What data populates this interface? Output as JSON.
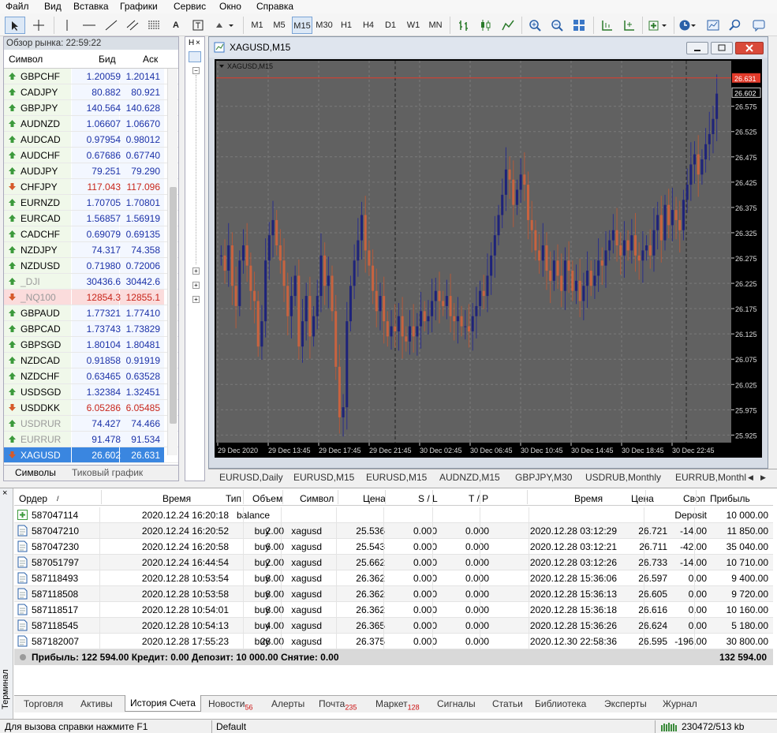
{
  "menu": [
    "Файл",
    "Вид",
    "Вставка",
    "Графики",
    "Сервис",
    "Окно",
    "Справка"
  ],
  "timeframes": [
    "M1",
    "M5",
    "M15",
    "M30",
    "H1",
    "H4",
    "D1",
    "W1",
    "MN"
  ],
  "active_timeframe": "M15",
  "market_watch": {
    "title": "Обзор рынка: 22:59:22",
    "col_symbol": "Символ",
    "col_bid": "Бид",
    "col_ask": "Аск",
    "rows": [
      {
        "symbol": "GBPCHF",
        "bid": "1.20059",
        "ask": "1.20141",
        "dir": "up",
        "color": "blue"
      },
      {
        "symbol": "CADJPY",
        "bid": "80.882",
        "ask": "80.921",
        "dir": "up",
        "color": "blue"
      },
      {
        "symbol": "GBPJPY",
        "bid": "140.564",
        "ask": "140.628",
        "dir": "up",
        "color": "blue"
      },
      {
        "symbol": "AUDNZD",
        "bid": "1.06607",
        "ask": "1.06670",
        "dir": "up",
        "color": "blue"
      },
      {
        "symbol": "AUDCAD",
        "bid": "0.97954",
        "ask": "0.98012",
        "dir": "up",
        "color": "blue"
      },
      {
        "symbol": "AUDCHF",
        "bid": "0.67686",
        "ask": "0.67740",
        "dir": "up",
        "color": "blue"
      },
      {
        "symbol": "AUDJPY",
        "bid": "79.251",
        "ask": "79.290",
        "dir": "up",
        "color": "blue"
      },
      {
        "symbol": "CHFJPY",
        "bid": "117.043",
        "ask": "117.096",
        "dir": "dn",
        "color": "red"
      },
      {
        "symbol": "EURNZD",
        "bid": "1.70705",
        "ask": "1.70801",
        "dir": "up",
        "color": "blue"
      },
      {
        "symbol": "EURCAD",
        "bid": "1.56857",
        "ask": "1.56919",
        "dir": "up",
        "color": "blue"
      },
      {
        "symbol": "CADCHF",
        "bid": "0.69079",
        "ask": "0.69135",
        "dir": "up",
        "color": "blue"
      },
      {
        "symbol": "NZDJPY",
        "bid": "74.317",
        "ask": "74.358",
        "dir": "up",
        "color": "blue"
      },
      {
        "symbol": "NZDUSD",
        "bid": "0.71980",
        "ask": "0.72006",
        "dir": "up",
        "color": "blue"
      },
      {
        "symbol": "_DJI",
        "bid": "30436.6",
        "ask": "30442.6",
        "dir": "up",
        "color": "blue",
        "dim": true
      },
      {
        "symbol": "_NQ100",
        "bid": "12854.3",
        "ask": "12855.1",
        "dir": "dn",
        "color": "red",
        "dim": true,
        "hl": true
      },
      {
        "symbol": "GBPAUD",
        "bid": "1.77321",
        "ask": "1.77410",
        "dir": "up",
        "color": "blue"
      },
      {
        "symbol": "GBPCAD",
        "bid": "1.73743",
        "ask": "1.73829",
        "dir": "up",
        "color": "blue"
      },
      {
        "symbol": "GBPSGD",
        "bid": "1.80104",
        "ask": "1.80481",
        "dir": "up",
        "color": "blue"
      },
      {
        "symbol": "NZDCAD",
        "bid": "0.91858",
        "ask": "0.91919",
        "dir": "up",
        "color": "blue"
      },
      {
        "symbol": "NZDCHF",
        "bid": "0.63465",
        "ask": "0.63528",
        "dir": "up",
        "color": "blue"
      },
      {
        "symbol": "USDSGD",
        "bid": "1.32384",
        "ask": "1.32451",
        "dir": "up",
        "color": "blue"
      },
      {
        "symbol": "USDDKK",
        "bid": "6.05286",
        "ask": "6.05485",
        "dir": "dn",
        "color": "red"
      },
      {
        "symbol": "USDRUR",
        "bid": "74.427",
        "ask": "74.466",
        "dir": "up",
        "color": "blue",
        "dim": true
      },
      {
        "symbol": "EURRUR",
        "bid": "91.478",
        "ask": "91.534",
        "dir": "up",
        "color": "blue",
        "dim": true
      },
      {
        "symbol": "XAGUSD",
        "bid": "26.602",
        "ask": "26.631",
        "dir": "dn",
        "color": "blue",
        "selected": true
      }
    ],
    "tabs": [
      "Символы",
      "Тиковый график"
    ]
  },
  "chart": {
    "window_title": "XAGUSD,M15",
    "inner_label": "XAGUSD,M15",
    "price_labels": [
      "26.575",
      "26.525",
      "26.475",
      "26.425",
      "26.375",
      "26.325",
      "26.275",
      "26.225",
      "26.175",
      "26.125",
      "26.075",
      "26.025",
      "25.975",
      "25.925"
    ],
    "ask_label": "26.631",
    "bid_label": "26.602",
    "time_labels": [
      "29 Dec 2020",
      "29 Dec 13:45",
      "29 Dec 17:45",
      "29 Dec 21:45",
      "30 Dec 02:45",
      "30 Dec 06:45",
      "30 Dec 10:45",
      "30 Dec 14:45",
      "30 Dec 18:45",
      "30 Dec 22:45"
    ],
    "chart_data": {
      "type": "candlestick",
      "symbol": "XAGUSD",
      "timeframe": "M15",
      "ylim": [
        25.91,
        26.665
      ],
      "closes": [
        26.28,
        26.25,
        26.3,
        26.22,
        26.18,
        26.27,
        26.3,
        26.26,
        26.21,
        26.19,
        26.1,
        26.15,
        26.27,
        26.32,
        26.35,
        26.3,
        26.27,
        26.22,
        26.16,
        26.2,
        26.24,
        26.1,
        26.15,
        26.2,
        26.12,
        26.16,
        26.2,
        26.28,
        26.22,
        26.24,
        26.17,
        26.06,
        25.96,
        25.98,
        26.15,
        26.22,
        26.27,
        26.31,
        26.36,
        26.29,
        26.26,
        26.21,
        26.17,
        26.2,
        26.15,
        26.12,
        26.14,
        26.13,
        26.16,
        26.12,
        26.11,
        26.14,
        26.12,
        26.14,
        26.17,
        26.15,
        26.16,
        26.19,
        26.21,
        26.19,
        26.18,
        26.2,
        26.16,
        26.15,
        26.16,
        26.14,
        26.14,
        26.13,
        26.16,
        26.18,
        26.21,
        26.2,
        26.24,
        26.28,
        26.32,
        26.36,
        26.4,
        26.45,
        26.43,
        26.38,
        26.41,
        26.44,
        26.42,
        26.35,
        26.33,
        26.29,
        26.27,
        26.3,
        26.25,
        26.23,
        26.27,
        26.24,
        26.21,
        26.27,
        26.25,
        26.21,
        26.23,
        26.19,
        26.22,
        26.25,
        26.22,
        26.24,
        26.27,
        26.26,
        26.29,
        26.31,
        26.33,
        26.3,
        26.28,
        26.31,
        26.29,
        26.32,
        26.28,
        26.27,
        26.29,
        26.3,
        26.28,
        26.33,
        26.36,
        26.31,
        26.38,
        26.34,
        26.37,
        26.35,
        26.33,
        26.39,
        26.42,
        26.46,
        26.48,
        26.44,
        26.47,
        26.5,
        26.52,
        26.55,
        26.6
      ]
    }
  },
  "chart_tabs": [
    "EURUSD,Daily",
    "EURUSD,M15",
    "EURUSD,M15",
    "AUDNZD,M15",
    "GBPJPY,M30",
    "USDRUB,Monthly",
    "EURRUB,Monthl"
  ],
  "terminal": {
    "side_label": "Терминал",
    "headers": [
      "Ордер",
      "Время",
      "Тип",
      "Объем",
      "Символ",
      "Цена",
      "S / L",
      "T / P",
      "Время",
      "Цена",
      "Своп",
      "Прибыль"
    ],
    "rows": [
      {
        "order": "587047114",
        "time": "2020.12.24 16:20:18",
        "type": "balance",
        "vol": "",
        "sym": "",
        "price": "",
        "sl": "",
        "tp": "",
        "time2": "",
        "price2": "",
        "swap": "Deposit",
        "profit": "10 000.00"
      },
      {
        "order": "587047210",
        "time": "2020.12.24 16:20:52",
        "type": "buy",
        "vol": "2.00",
        "sym": "xagusd",
        "price": "25.536",
        "sl": "0.000",
        "tp": "0.000",
        "time2": "2020.12.28 03:12:29",
        "price2": "26.721",
        "swap": "-14.00",
        "profit": "11 850.00"
      },
      {
        "order": "587047230",
        "time": "2020.12.24 16:20:58",
        "type": "buy",
        "vol": "6.00",
        "sym": "xagusd",
        "price": "25.543",
        "sl": "0.000",
        "tp": "0.000",
        "time2": "2020.12.28 03:12:21",
        "price2": "26.711",
        "swap": "-42.00",
        "profit": "35 040.00"
      },
      {
        "order": "587051797",
        "time": "2020.12.24 16:44:54",
        "type": "buy",
        "vol": "2.00",
        "sym": "xagusd",
        "price": "25.662",
        "sl": "0.000",
        "tp": "0.000",
        "time2": "2020.12.28 03:12:26",
        "price2": "26.733",
        "swap": "-14.00",
        "profit": "10 710.00"
      },
      {
        "order": "587118493",
        "time": "2020.12.28 10:53:54",
        "type": "buy",
        "vol": "8.00",
        "sym": "xagusd",
        "price": "26.362",
        "sl": "0.000",
        "tp": "0.000",
        "time2": "2020.12.28 15:36:06",
        "price2": "26.597",
        "swap": "0.00",
        "profit": "9 400.00"
      },
      {
        "order": "587118508",
        "time": "2020.12.28 10:53:58",
        "type": "buy",
        "vol": "8.00",
        "sym": "xagusd",
        "price": "26.362",
        "sl": "0.000",
        "tp": "0.000",
        "time2": "2020.12.28 15:36:13",
        "price2": "26.605",
        "swap": "0.00",
        "profit": "9 720.00"
      },
      {
        "order": "587118517",
        "time": "2020.12.28 10:54:01",
        "type": "buy",
        "vol": "8.00",
        "sym": "xagusd",
        "price": "26.362",
        "sl": "0.000",
        "tp": "0.000",
        "time2": "2020.12.28 15:36:18",
        "price2": "26.616",
        "swap": "0.00",
        "profit": "10 160.00"
      },
      {
        "order": "587118545",
        "time": "2020.12.28 10:54:13",
        "type": "buy",
        "vol": "4.00",
        "sym": "xagusd",
        "price": "26.365",
        "sl": "0.000",
        "tp": "0.000",
        "time2": "2020.12.28 15:36:26",
        "price2": "26.624",
        "swap": "0.00",
        "profit": "5 180.00"
      },
      {
        "order": "587182007",
        "time": "2020.12.28 17:55:23",
        "type": "buy",
        "vol": "28.00",
        "sym": "xagusd",
        "price": "26.375",
        "sl": "0.000",
        "tp": "0.000",
        "time2": "2020.12.30 22:58:36",
        "price2": "26.595",
        "swap": "-196.00",
        "profit": "30 800.00"
      }
    ],
    "summary": "Прибыль: 122 594.00  Кредит: 0.00  Депозит: 10 000.00  Снятие: 0.00",
    "summary_total": "132 594.00",
    "tabs": [
      {
        "label": "Торговля"
      },
      {
        "label": "Активы"
      },
      {
        "label": "История Счета",
        "active": true
      },
      {
        "label": "Новости",
        "badge": "56"
      },
      {
        "label": "Алерты"
      },
      {
        "label": "Почта",
        "badge": "235"
      },
      {
        "label": "Маркет",
        "badge": "128"
      },
      {
        "label": "Сигналы"
      },
      {
        "label": "Статьи"
      },
      {
        "label": "Библиотека"
      },
      {
        "label": "Эксперты"
      },
      {
        "label": "Журнал"
      }
    ]
  },
  "status": {
    "help": "Для вызова справки нажмите F1",
    "profile": "Default",
    "traffic": "230472/513 kb"
  }
}
